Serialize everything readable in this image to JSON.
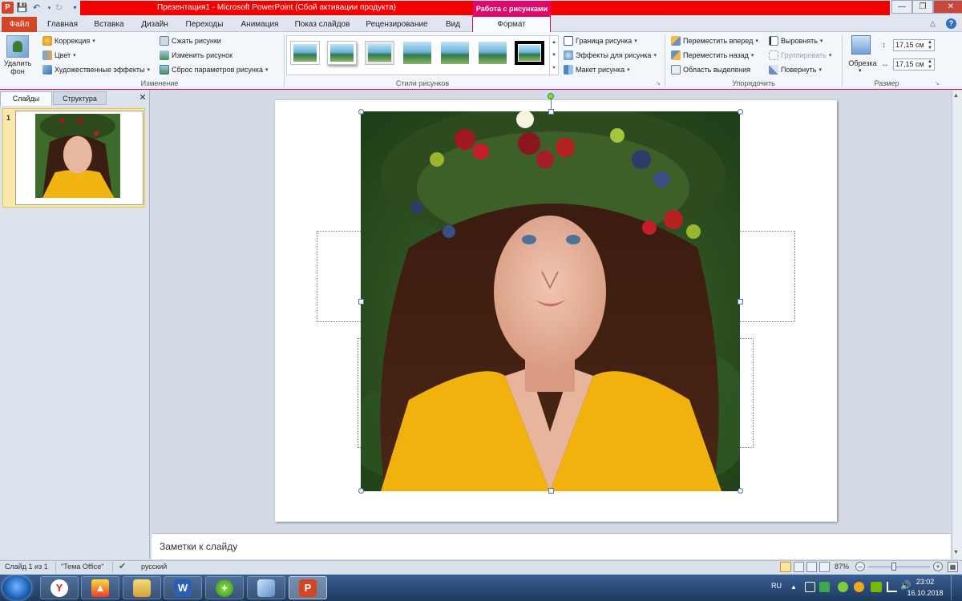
{
  "window": {
    "title": "Презентация1  -  Microsoft PowerPoint (Сбой активации продукта)",
    "context_tab_header": "Работа с рисунками"
  },
  "tabs": [
    "Файл",
    "Главная",
    "Вставка",
    "Дизайн",
    "Переходы",
    "Анимация",
    "Показ слайдов",
    "Рецензирование",
    "Вид",
    "Формат"
  ],
  "ribbon": {
    "remove_bg": "Удалить фон",
    "group_change": {
      "label": "Изменение",
      "correction": "Коррекция",
      "color": "Цвет",
      "artistic_effects": "Художественные эффекты",
      "compress": "Сжать рисунки",
      "change_picture": "Изменить рисунок",
      "reset_picture": "Сброс параметров рисунка"
    },
    "group_styles": {
      "label": "Стили рисунков",
      "border": "Граница рисунка",
      "effects": "Эффекты для рисунка",
      "layout": "Макет рисунка"
    },
    "group_arrange": {
      "label": "Упорядочить",
      "bring_forward": "Переместить вперед",
      "send_backward": "Переместить назад",
      "selection_pane": "Область выделения",
      "align": "Выровнять",
      "group": "Группировать",
      "rotate": "Повернуть"
    },
    "group_size": {
      "label": "Размер",
      "crop": "Обрезка",
      "height": "17,15 см",
      "width": "17,15 см"
    }
  },
  "left_pane": {
    "tab_slides": "Слайды",
    "tab_outline": "Структура",
    "slide_number": "1"
  },
  "notes_placeholder": "Заметки к слайду",
  "status": {
    "slide_info": "Слайд 1 из 1",
    "theme": "\"Тема Office\"",
    "language": "русский",
    "zoom": "87%"
  },
  "taskbar": {
    "lang": "RU",
    "time": "23:02",
    "date": "16.10.2018",
    "apps": [
      "yandex-browser",
      "yandex-disk",
      "file-explorer",
      "word",
      "downloader",
      "notebook",
      "powerpoint"
    ]
  },
  "colors": {
    "accent_red": "#f50000",
    "context_pink": "#e0086a",
    "file_tab": "#d24625",
    "thumb_selected": "#fce9a9"
  }
}
